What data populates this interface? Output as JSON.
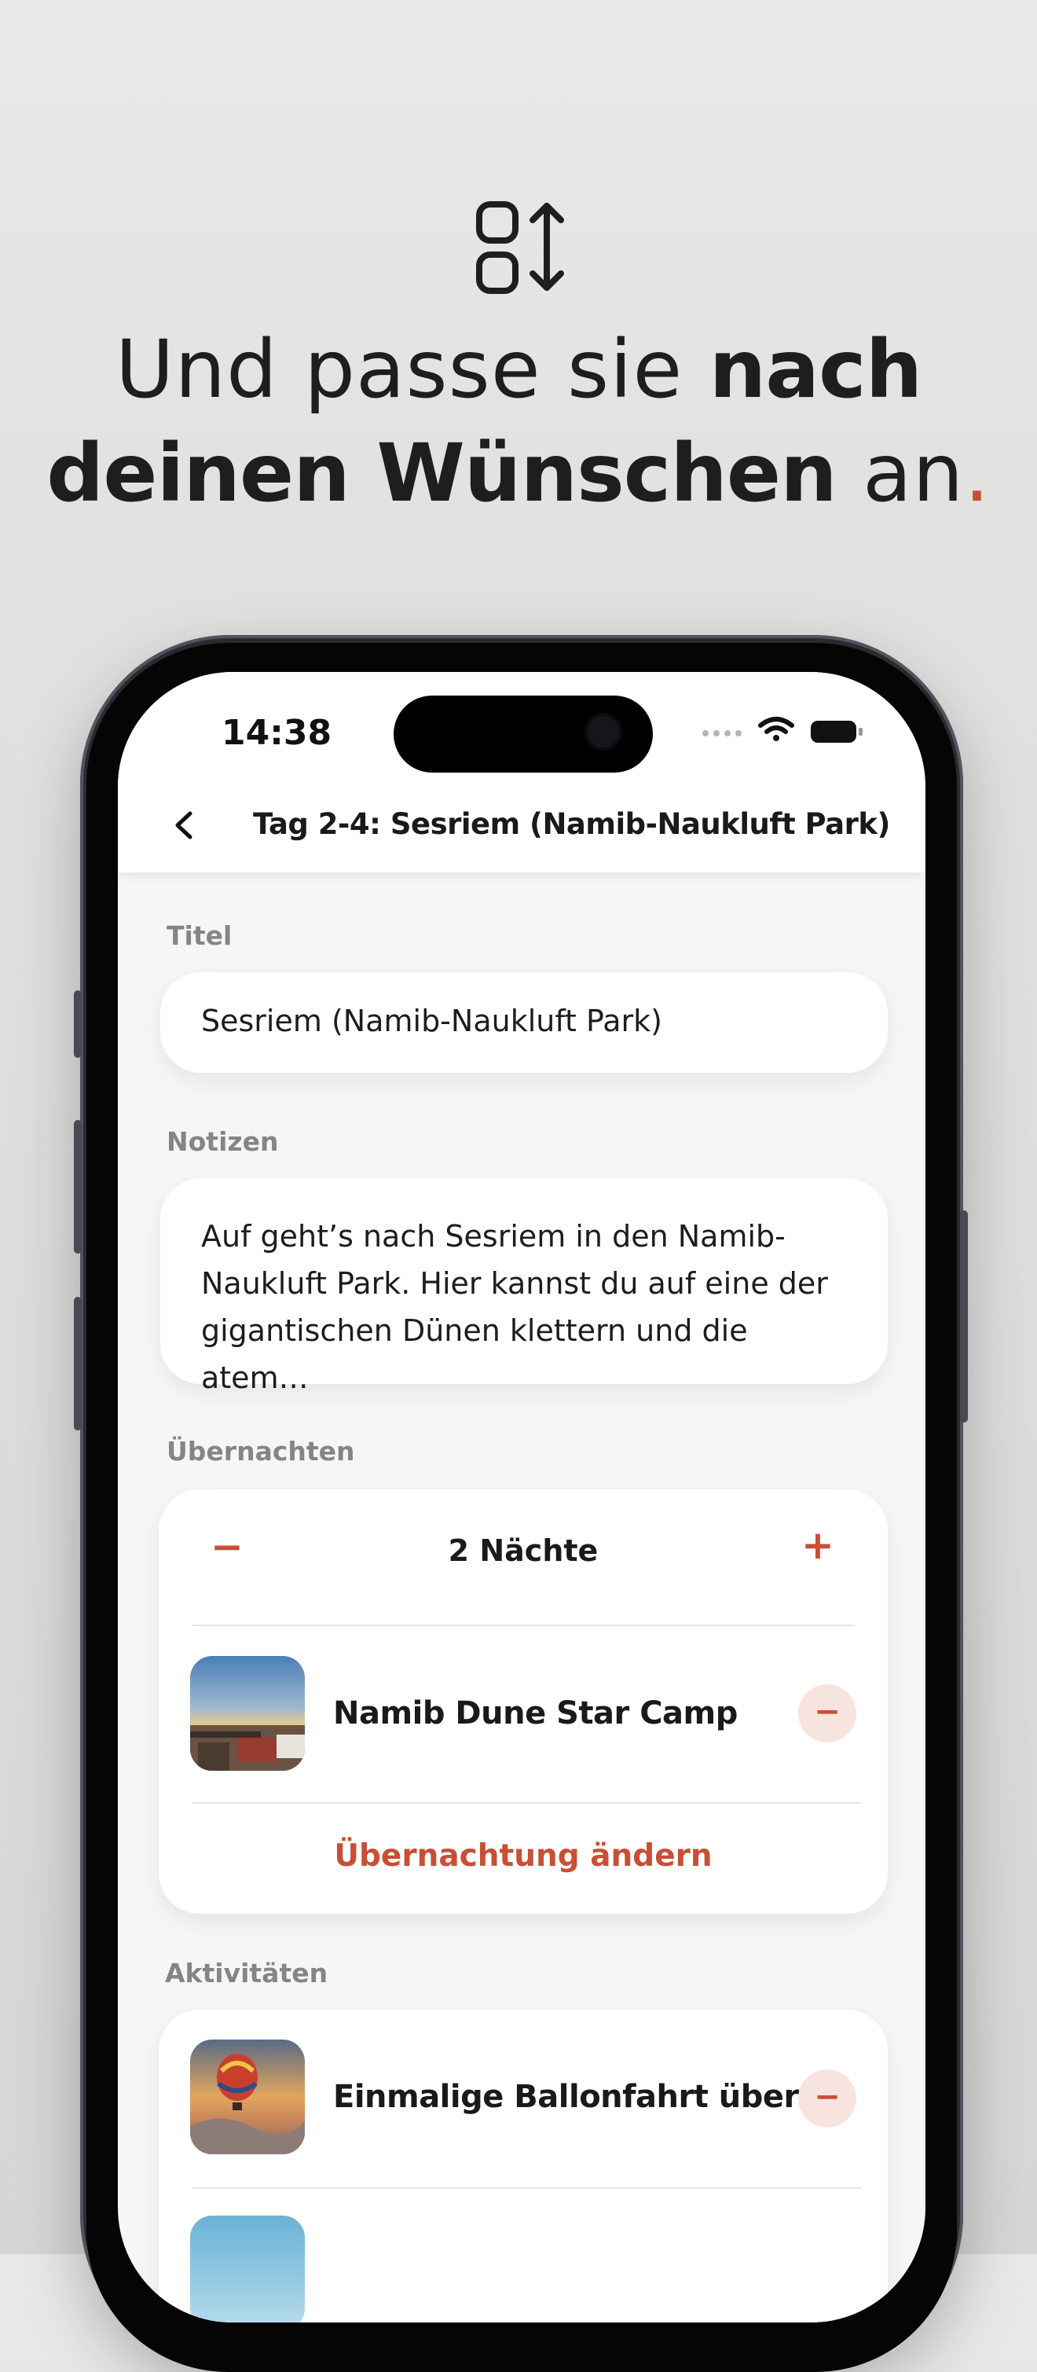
{
  "headline": {
    "part1": "Und passe sie ",
    "bold1": "nach",
    "bold2": "deinen Wünschen",
    "part2": " an",
    "dot": "."
  },
  "colors": {
    "accent": "#c84f35",
    "text": "#1a1a1a",
    "label": "#858585"
  },
  "status_bar": {
    "time": "14:38",
    "icons": [
      "wifi-icon",
      "battery-icon"
    ]
  },
  "nav": {
    "back_icon": "chevron-left-icon",
    "title": "Tag 2-4: Sesriem (Namib-Naukluft Park)"
  },
  "form": {
    "title_label": "Titel",
    "title_value": "Sesriem (Namib-Naukluft Park)",
    "notes_label": "Notizen",
    "notes_value": "Auf geht’s nach Sesriem in den Namib-Naukluft Park. Hier kannst du auf eine der gigantischen Dünen klettern und die atem…"
  },
  "overnight": {
    "label": "Übernachten",
    "minus": "−",
    "plus": "+",
    "nights": "2 Nächte",
    "accommodation": "Namib Dune Star Camp",
    "remove": "−",
    "change_link": "Übernachtung ändern"
  },
  "activities": {
    "label": "Aktivitäten",
    "items": [
      {
        "title": "Einmalige Ballonfahrt über…",
        "remove": "−"
      }
    ]
  }
}
